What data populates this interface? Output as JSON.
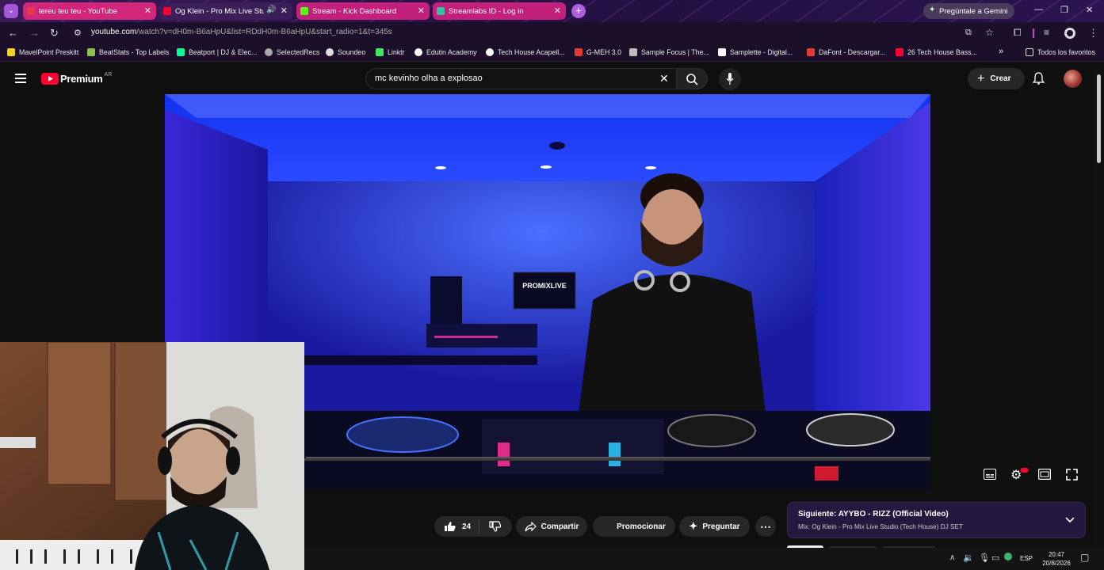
{
  "tabs": [
    {
      "label": "tereu teu teu - YouTube",
      "color": "#d32f4a",
      "active": false
    },
    {
      "label": "Og Klein - Pro Mix Live Stu",
      "color": "#ff0033",
      "active": true
    },
    {
      "label": "Stream - Kick Dashboard",
      "color": "#53fc18",
      "active": false
    },
    {
      "label": "Streamlabs ID - Log in",
      "color": "#31c3a2",
      "active": false
    }
  ],
  "gemini_label": "Pregúntale a Gemini",
  "address": {
    "host": "youtube.com",
    "path": "/watch?v=dH0m-B6aHpU&list=RDdH0m-B6aHpU&start_radio=1&t=345s"
  },
  "bookmarks": [
    {
      "label": "MavelPoint Preskitt",
      "color": "#f3d21a"
    },
    {
      "label": "BeatStats - Top Labels",
      "color": "#8bc34a"
    },
    {
      "label": "Beatport | DJ & Elec...",
      "color": "#01ff95"
    },
    {
      "label": "SelectedRecs",
      "color": "#aaaaaa"
    },
    {
      "label": "Soundeo",
      "color": "#dddddd"
    },
    {
      "label": "Linktr",
      "color": "#43e55e"
    },
    {
      "label": "Edutin Academy",
      "color": "#ffffff"
    },
    {
      "label": "Tech House Acapell...",
      "color": "#ffffff"
    },
    {
      "label": "G-MEH 3.0",
      "color": "#e53935"
    },
    {
      "label": "Sample Focus | The...",
      "color": "#bbbbbb"
    },
    {
      "label": "Samplette - Digital...",
      "color": "#ffffff"
    },
    {
      "label": "DaFont - Descargar...",
      "color": "#e53935"
    },
    {
      "label": "26 Tech House Bass...",
      "color": "#ff0033"
    }
  ],
  "bookmarks_more": "»",
  "all_favorites": "Todos los favoritos",
  "yt": {
    "logo_text": "Premium",
    "region": "AR",
    "search_value": "mc kevinho olha a explosao",
    "create_label": "Crear"
  },
  "video": {
    "overlay_text": "PROMIXLIVE"
  },
  "actions": {
    "like_count": "24",
    "share_label": "Compartir",
    "promote_label": "Promocionar",
    "ask_label": "Preguntar"
  },
  "next_up": {
    "title": "Siguiente: AYYBO - RIZZ (Official Video)",
    "subtitle": "Mix: Og Klein - Pro Mix Live Studio (Tech House) DJ SET"
  },
  "taskbar": {
    "lang": "ESP",
    "time": "20:47",
    "date": "20/8/2026"
  },
  "colors": {
    "yt_red": "#ff0033",
    "tab_bg": "#2a1248",
    "accent": "#a455d8"
  },
  "icons": [
    "menu-icon",
    "youtube-logo-icon",
    "search-icon",
    "mic-icon",
    "bell-icon",
    "like-icon",
    "dislike-icon",
    "share-icon",
    "sparkle-icon",
    "more-icon",
    "chevron-down-icon",
    "subtitles-icon",
    "settings-icon",
    "theater-icon",
    "fullscreen-icon"
  ]
}
